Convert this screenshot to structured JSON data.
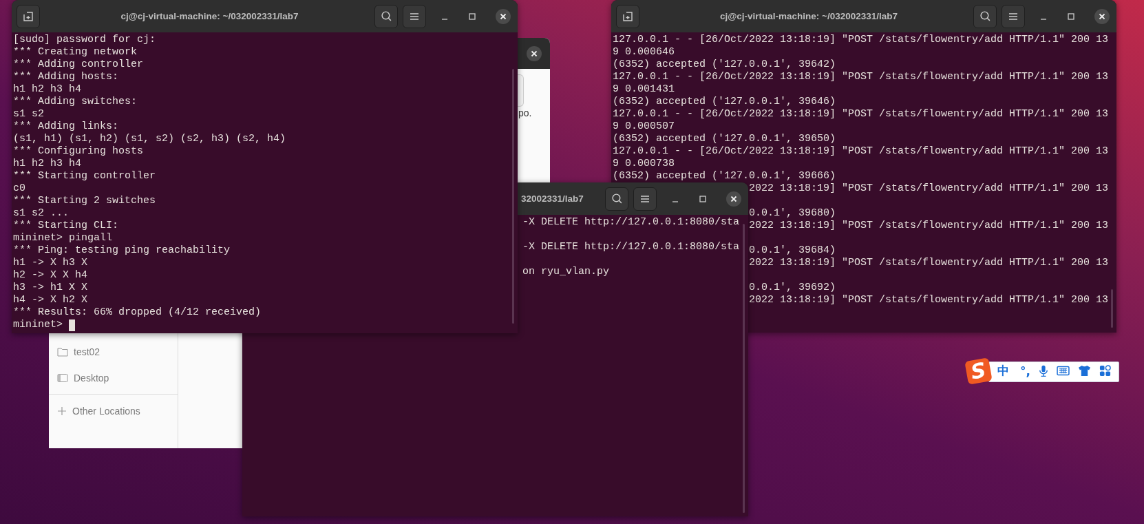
{
  "file_dialog": {
    "fragment": "po.",
    "sidebar_items": [
      {
        "kind": "folder",
        "label": "test02"
      },
      {
        "kind": "desktop",
        "label": "Desktop"
      },
      {
        "kind": "add",
        "label": "Other Locations"
      }
    ]
  },
  "terminals": [
    {
      "title": "cj@cj-virtual-machine: ~/032002331/lab7",
      "lines": [
        {
          "kind": "full",
          "text": "[sudo] password for cj:"
        },
        {
          "kind": "full",
          "text": "*** Creating network"
        },
        {
          "kind": "full",
          "text": "*** Adding controller"
        },
        {
          "kind": "full",
          "text": "*** Adding hosts:"
        },
        {
          "kind": "full",
          "text": "h1 h2 h3 h4"
        },
        {
          "kind": "full",
          "text": "*** Adding switches:"
        },
        {
          "kind": "full",
          "text": "s1 s2"
        },
        {
          "kind": "full",
          "text": "*** Adding links:"
        },
        {
          "kind": "full",
          "text": "(s1, h1) (s1, h2) (s1, s2) (s2, h3) (s2, h4)"
        },
        {
          "kind": "full",
          "text": "*** Configuring hosts"
        },
        {
          "kind": "full",
          "text": "h1 h2 h3 h4"
        },
        {
          "kind": "full",
          "text": "*** Starting controller"
        },
        {
          "kind": "full",
          "text": "c0"
        },
        {
          "kind": "full",
          "text": "*** Starting 2 switches"
        },
        {
          "kind": "full",
          "text": "s1 s2 ..."
        },
        {
          "kind": "full",
          "text": "*** Starting CLI:"
        },
        {
          "kind": "full",
          "text": "mininet> pingall"
        },
        {
          "kind": "full",
          "text": "*** Ping: testing ping reachability"
        },
        {
          "kind": "full",
          "text": "h1 -> X h3 X"
        },
        {
          "kind": "full",
          "text": "h2 -> X X h4"
        },
        {
          "kind": "full",
          "text": "h3 -> h1 X X"
        },
        {
          "kind": "full",
          "text": "h4 -> X h2 X"
        },
        {
          "kind": "full",
          "text": "*** Results: 66% dropped (4/12 received)"
        },
        {
          "kind": "prompt",
          "text": "mininet>"
        }
      ]
    },
    {
      "title": "cj@cj-virtual-machine: ~/032002331/lab7",
      "lines": [
        {
          "kind": "full",
          "text": "127.0.0.1 - - [26/Oct/2022 13:18:19] \"POST /stats/flowentry/add HTTP/1.1\" 200 13"
        },
        {
          "kind": "full",
          "text": "9 0.000646"
        },
        {
          "kind": "full",
          "text": "(6352) accepted ('127.0.0.1', 39642)"
        },
        {
          "kind": "full",
          "text": "127.0.0.1 - - [26/Oct/2022 13:18:19] \"POST /stats/flowentry/add HTTP/1.1\" 200 13"
        },
        {
          "kind": "full",
          "text": "9 0.001431"
        },
        {
          "kind": "full",
          "text": "(6352) accepted ('127.0.0.1', 39646)"
        },
        {
          "kind": "full",
          "text": "127.0.0.1 - - [26/Oct/2022 13:18:19] \"POST /stats/flowentry/add HTTP/1.1\" 200 13"
        },
        {
          "kind": "full",
          "text": "9 0.000507"
        },
        {
          "kind": "full",
          "text": "(6352) accepted ('127.0.0.1', 39650)"
        },
        {
          "kind": "full",
          "text": "127.0.0.1 - - [26/Oct/2022 13:18:19] \"POST /stats/flowentry/add HTTP/1.1\" 200 13"
        },
        {
          "kind": "full",
          "text": "9 0.000738"
        },
        {
          "kind": "full",
          "text": "(6352) accepted ('127.0.0.1', 39666)"
        },
        {
          "kind": "tail",
          "text": "2022 13:18:19] \"POST /stats/flowentry/add HTTP/1.1\" 200 13"
        },
        {
          "kind": "tail-gap",
          "text": "0.0.1', 39680)"
        },
        {
          "kind": "tail",
          "text": "2022 13:18:19] \"POST /stats/flowentry/add HTTP/1.1\" 200 13"
        },
        {
          "kind": "tail-gap",
          "text": "0.0.1', 39684)"
        },
        {
          "kind": "tail",
          "text": "2022 13:18:19] \"POST /stats/flowentry/add HTTP/1.1\" 200 13"
        },
        {
          "kind": "tail-gap",
          "text": "0.0.1', 39692)"
        },
        {
          "kind": "tail",
          "text": "2022 13:18:19] \"POST /stats/flowentry/add HTTP/1.1\" 200 13"
        }
      ]
    },
    {
      "title": "32002331/lab7",
      "lines": [
        {
          "kind": "tail",
          "text": "-X DELETE http://127.0.0.1:8080/sta"
        },
        {
          "kind": "tail-gap",
          "text": "-X DELETE http://127.0.0.1:8080/sta"
        },
        {
          "kind": "tail-gap",
          "text": "on ryu_vlan.py"
        }
      ]
    }
  ],
  "ime_bar": {
    "logo": "S",
    "mode": "中",
    "punctuation": "°,"
  }
}
